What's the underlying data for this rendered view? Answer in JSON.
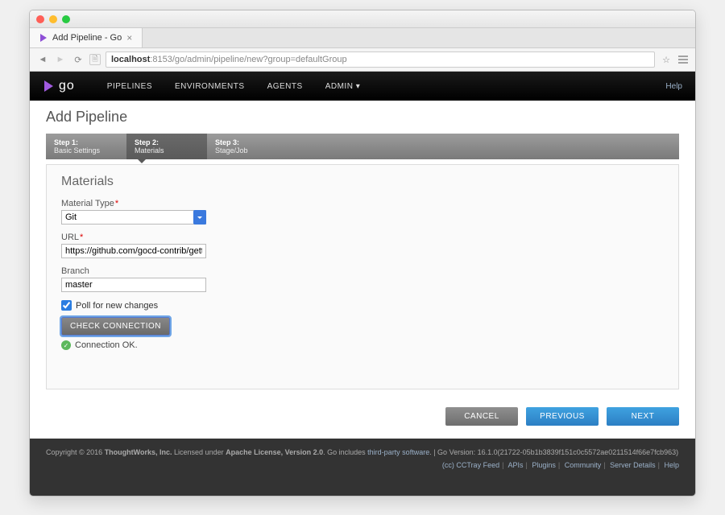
{
  "browser": {
    "tab_title": "Add Pipeline - Go",
    "url_host": "localhost",
    "url_path": ":8153/go/admin/pipeline/new?group=defaultGroup"
  },
  "nav": {
    "brand": "go",
    "pipelines": "PIPELINES",
    "environments": "ENVIRONMENTS",
    "agents": "AGENTS",
    "admin": "ADMIN ▾",
    "help": "Help"
  },
  "page": {
    "title": "Add Pipeline"
  },
  "wizard": {
    "steps": [
      {
        "title": "Step 1:",
        "sub": "Basic Settings"
      },
      {
        "title": "Step 2:",
        "sub": "Materials"
      },
      {
        "title": "Step 3:",
        "sub": "Stage/Job"
      }
    ]
  },
  "form": {
    "section_title": "Materials",
    "material_type_label": "Material Type",
    "material_type_value": "Git",
    "url_label": "URL",
    "url_value": "https://github.com/gocd-contrib/getting-started",
    "branch_label": "Branch",
    "branch_value": "master",
    "poll_label": "Poll for new changes",
    "poll_checked": true,
    "check_btn": "CHECK CONNECTION",
    "status_text": "Connection OK."
  },
  "actions": {
    "cancel": "CANCEL",
    "previous": "PREVIOUS",
    "next": "NEXT"
  },
  "footer": {
    "copyright_prefix": "Copyright © 2016 ",
    "company": "ThoughtWorks, Inc.",
    "license_prefix": " Licensed under ",
    "license": "Apache License, Version 2.0",
    "tp_prefix": ". Go includes ",
    "tp": "third-party software",
    "tp_suffix": ".",
    "version_prefix": "  |  Go Version: ",
    "version": "16.1.0(21722-05b1b3839f151c0c5572ae0211514f66e7fcb963)",
    "links": {
      "cctray": "(cc) CCTray Feed",
      "apis": "APIs",
      "plugins": "Plugins",
      "community": "Community",
      "server": "Server Details",
      "help": "Help"
    }
  }
}
